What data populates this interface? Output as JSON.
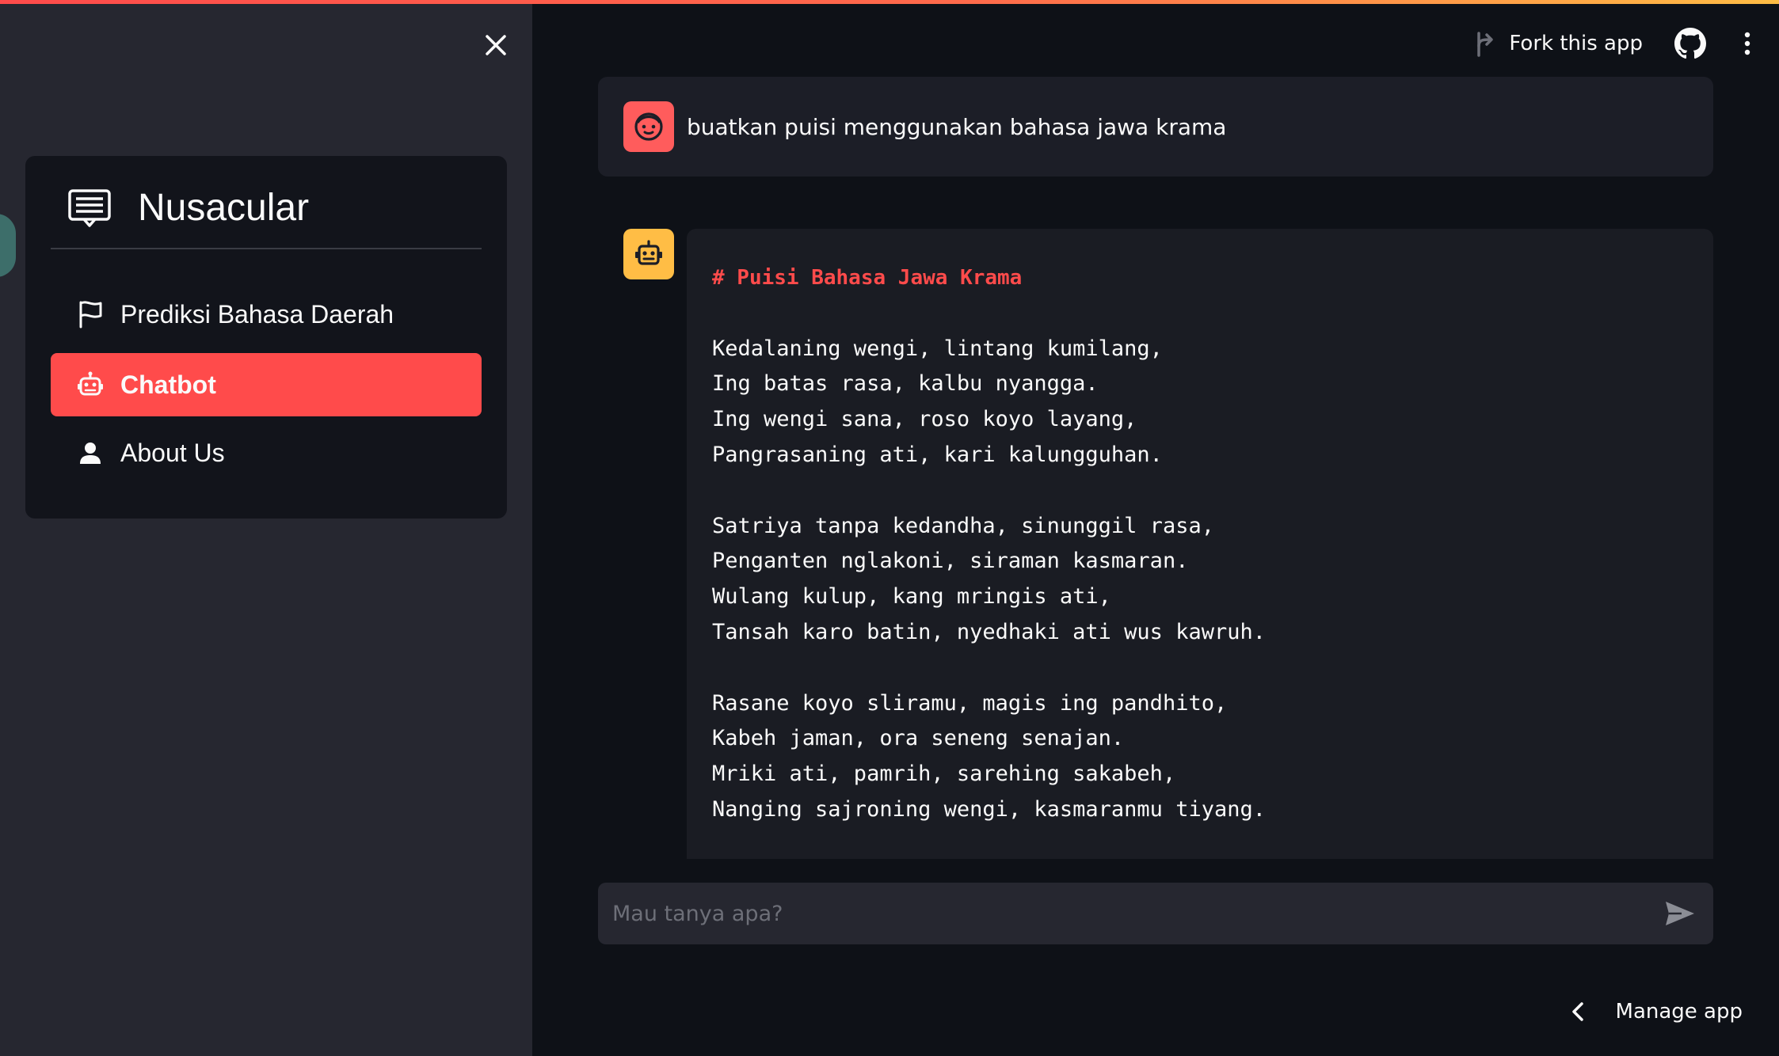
{
  "sidebar": {
    "title": "Nusacular",
    "items": [
      {
        "label": "Prediksi Bahasa Daerah",
        "icon": "flag-icon"
      },
      {
        "label": "Chatbot",
        "icon": "robot-icon",
        "active": true
      },
      {
        "label": "About Us",
        "icon": "person-icon"
      }
    ]
  },
  "header": {
    "fork_label": "Fork this app"
  },
  "chat": {
    "user_message": "buatkan puisi menggunakan bahasa jawa krama",
    "response": {
      "title": "# Puisi Bahasa Jawa Krama",
      "stanzas": [
        [
          "Kedalaning wengi, lintang kumilang,",
          "Ing batas rasa, kalbu nyangga.",
          "Ing wengi sana, roso koyo layang,",
          "Pangrasaning ati, kari kalungguhan."
        ],
        [
          "Satriya tanpa kedandha, sinunggil rasa,",
          "Penganten nglakoni, siraman kasmaran.",
          "Wulang kulup, kang mringis ati,",
          "Tansah karo batin, nyedhaki ati wus kawruh."
        ],
        [
          "Rasane koyo sliramu, magis ing pandhito,",
          "Kabeh jaman, ora seneng senajan.",
          "Mriki ati, pamrih, sarehing sakabeh,",
          "Nanging sajroning wengi, kasmaranmu tiyang."
        ]
      ]
    },
    "input_placeholder": "Mau tanya apa?"
  },
  "footer": {
    "manage_label": "Manage app"
  },
  "colors": {
    "accent": "#ff4b4b",
    "bot_avatar": "#ffbd45",
    "sidebar_bg": "#262730",
    "main_bg": "#0e1117"
  }
}
